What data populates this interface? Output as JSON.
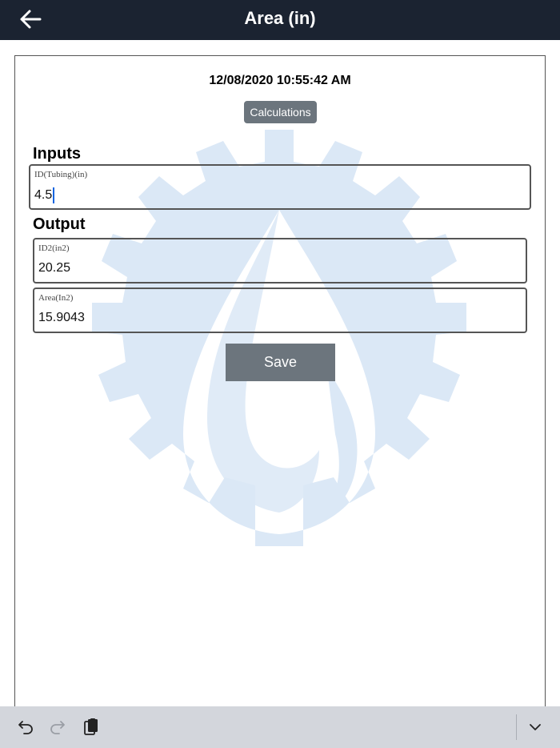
{
  "header": {
    "title": "Area (in)",
    "back_icon": "arrow-left-icon"
  },
  "timestamp": "12/08/2020 10:55:42 AM",
  "calculations_label": "Calculations",
  "inputs": {
    "title": "Inputs",
    "fields": [
      {
        "label": "ID(Tubing)(in)",
        "value": "4.5"
      }
    ]
  },
  "output": {
    "title": "Output",
    "fields": [
      {
        "label": "ID2(in2)",
        "value": "20.25"
      },
      {
        "label": "Area(In2)",
        "value": "15.9043"
      }
    ]
  },
  "save_label": "Save",
  "colors": {
    "header_bg": "#1b2331",
    "button_bg": "#6c757d",
    "watermark": "#dbe8f6",
    "caret": "#1565e0",
    "keyboard_bar": "#d3d6dc"
  },
  "keyboard_toolbar": {
    "icons": [
      "undo-icon",
      "redo-icon",
      "paste-icon",
      "chevron-down-icon"
    ]
  }
}
